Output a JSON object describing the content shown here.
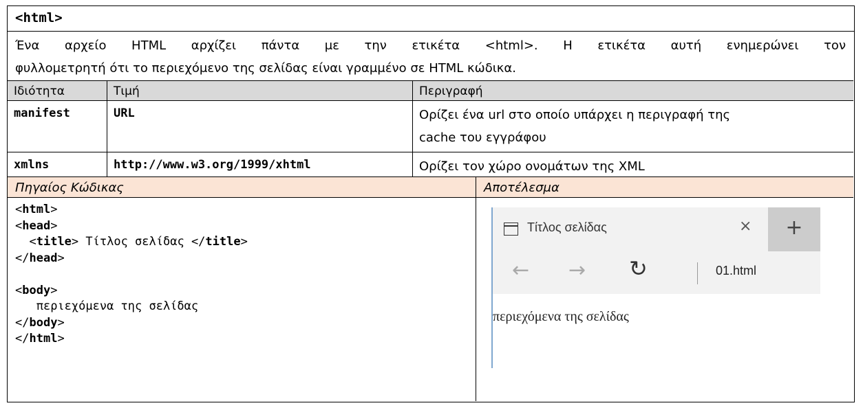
{
  "tag_title": "<html>",
  "description": {
    "line1": "Ένα αρχείο HTML αρχίζει πάντα με την ετικέτα <html>. Η ετικέτα αυτή ενημερώνει τον",
    "line2": "φυλλομετρητή ότι το περιεχόμενο της σελίδας είναι γραμμένο σε HTML κώδικα."
  },
  "attributes_table": {
    "headers": [
      "Ιδιότητα",
      "Τιμή",
      "Περιγραφή"
    ],
    "rows": [
      {
        "attribute": "manifest",
        "value": "URL",
        "description_line1": "Ορίζει ένα url στο οποίο υπάρχει η περιγραφή της",
        "description_line2": "cache του εγγράφου"
      },
      {
        "attribute": "xmlns",
        "value": "http://www.w3.org/1999/xhtml",
        "description_line1": "Ορίζει τον χώρο ονομάτων της XML"
      }
    ]
  },
  "source_header": "Πηγαίος Κώδικας",
  "result_header": "Αποτέλεσμα",
  "source_code": {
    "lt": "<",
    "gt": ">",
    "lts": "</",
    "html": "html",
    "head": "head",
    "title": "title",
    "body": "body",
    "title_text": " Τίτλος σελίδας ",
    "body_text": "περιεχόμενα της σελίδας"
  },
  "browser": {
    "tab_title": "Τίτλος σελίδας",
    "tab_icon": "window-icon",
    "close_glyph": "×",
    "new_tab_glyph": "+",
    "back_glyph": "←",
    "forward_glyph": "→",
    "refresh_glyph": "↻",
    "address": "01.html",
    "page_text": "περιεχόμενα της σελίδας"
  }
}
